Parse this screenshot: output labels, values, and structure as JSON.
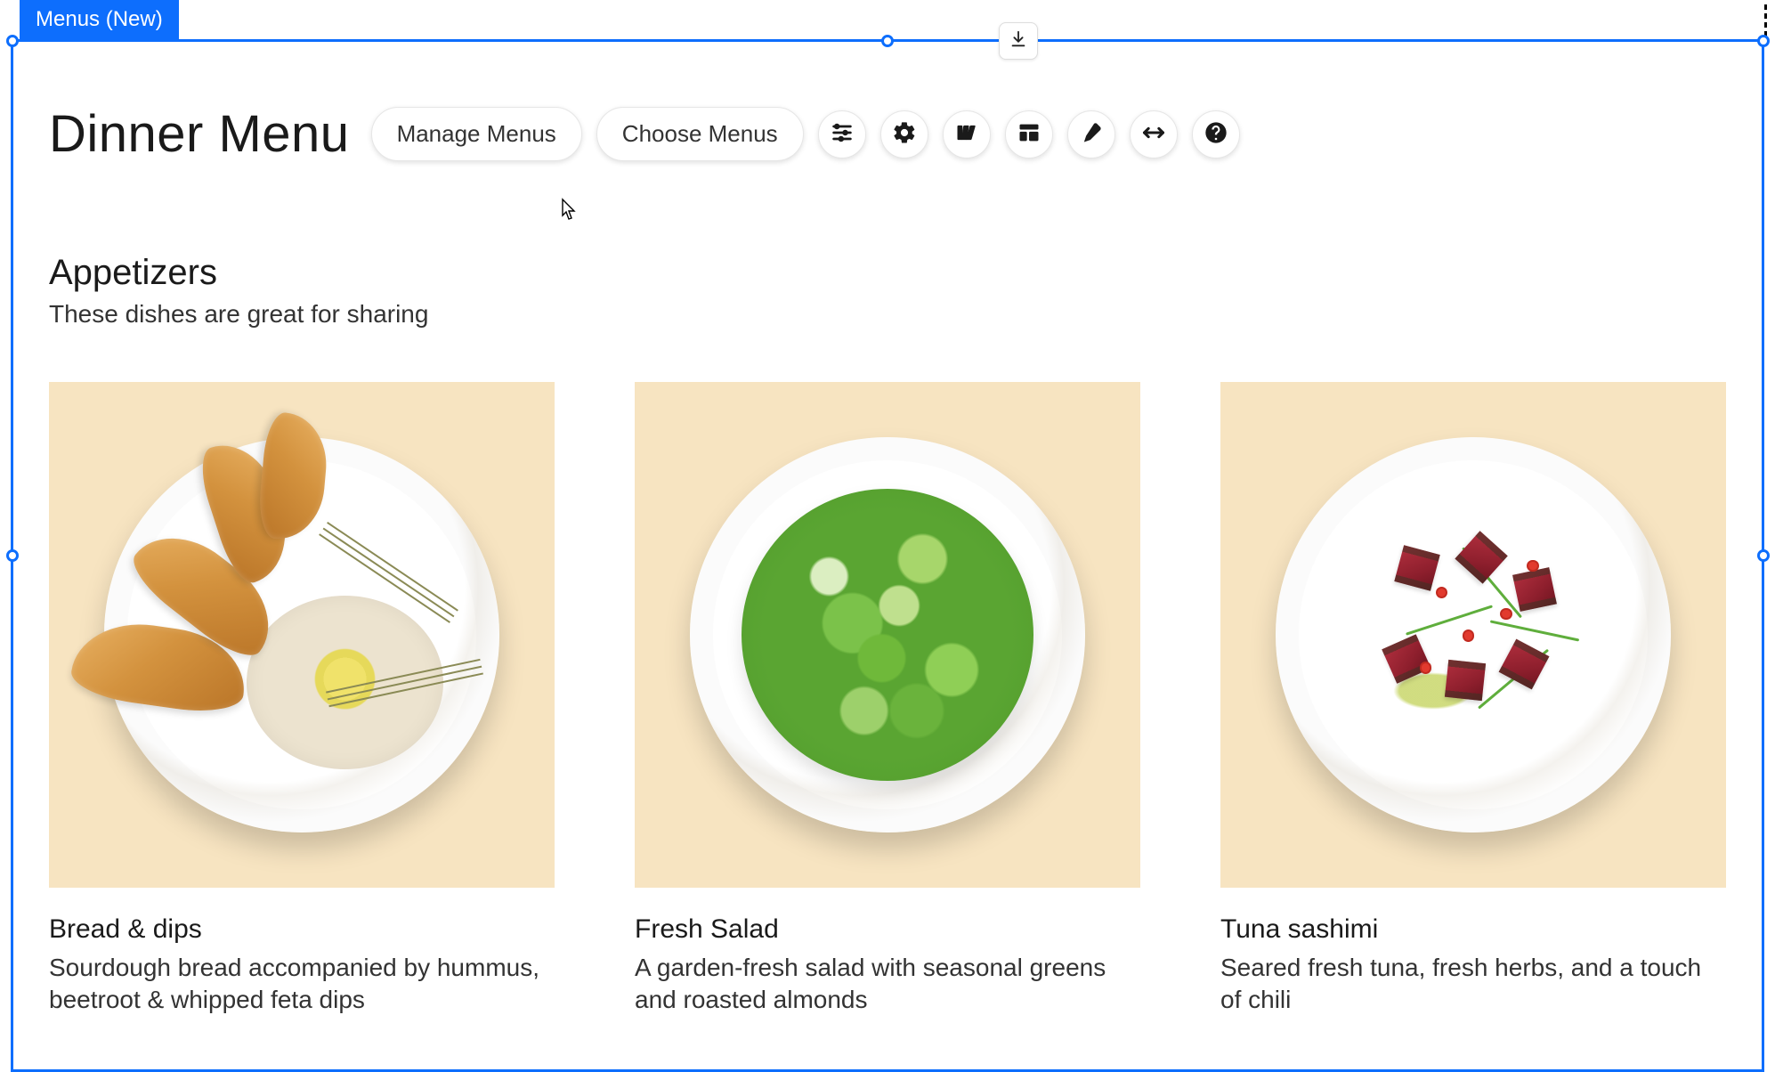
{
  "widget_tag": "Menus (New)",
  "page_title": "Dinner Menu",
  "toolbar": {
    "manage_label": "Manage Menus",
    "choose_label": "Choose Menus"
  },
  "section": {
    "title": "Appetizers",
    "subtitle": "These dishes are great for sharing"
  },
  "items": [
    {
      "name": "Bread & dips",
      "desc": "Sourdough bread accompanied by hummus, beetroot & whipped feta dips"
    },
    {
      "name": "Fresh Salad",
      "desc": "A garden-fresh salad with seasonal greens and roasted almonds"
    },
    {
      "name": "Tuna sashimi",
      "desc": "Seared fresh tuna, fresh herbs, and a touch of chili"
    }
  ]
}
